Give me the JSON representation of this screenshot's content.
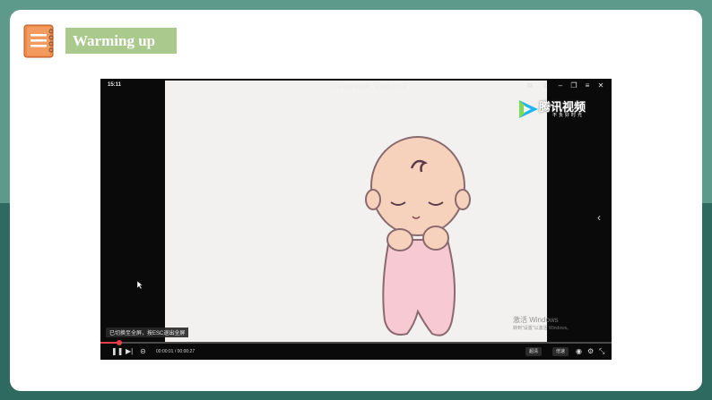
{
  "section": {
    "title": "Warming up"
  },
  "player": {
    "clock": "15:11",
    "video_title": "三十秒思考动画：从出生到老去",
    "brand": {
      "name": "腾讯视频",
      "slogan": "不负好时光"
    },
    "toast": "已切换至全屏，按ESC退出全屏",
    "watermark": {
      "line1": "激活 Windows",
      "line2": "转到\"设置\"以激活 Windows。"
    },
    "time": "00:00:01 / 00:00:27",
    "progress": 0.037,
    "buttons": {
      "quality": "超清",
      "speed": "倍速"
    },
    "icons": [
      "pause-icon",
      "next-icon",
      "danmaku-icon",
      "pip-icon",
      "download-icon",
      "minimize-icon",
      "restore-icon",
      "close-icon",
      "volume-icon",
      "settings-icon",
      "exit-fullscreen-icon"
    ]
  },
  "colors": {
    "bg_top": "#5e9a8c",
    "bg_bottom": "#2f6a60",
    "title_bg": "#a9c98d",
    "progress": "#e8404a",
    "icon_orange": "#f08a4b"
  }
}
